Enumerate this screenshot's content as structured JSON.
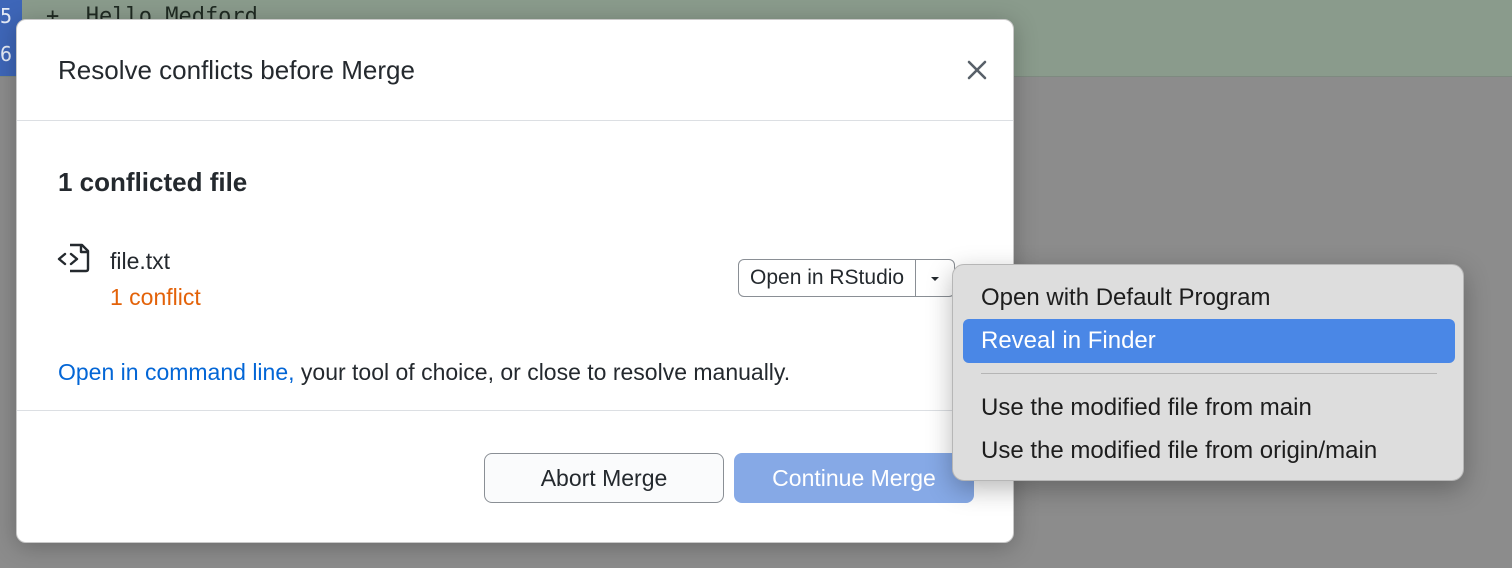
{
  "background": {
    "line_numbers": [
      "5",
      "6"
    ],
    "diff_line": "+  Hello Medford"
  },
  "dialog": {
    "title": "Resolve conflicts before Merge",
    "section_title": "1 conflicted file",
    "file": {
      "name": "file.txt",
      "conflicts": "1 conflict",
      "open_button_label": "Open in RStudio"
    },
    "footnote_link": "Open in command line,",
    "footnote_text": " your tool of choice, or close to resolve manually.",
    "abort_label": "Abort Merge",
    "continue_label": "Continue Merge"
  },
  "context_menu": {
    "items": [
      "Open with Default Program",
      "Reveal in Finder",
      "Use the modified file from main",
      "Use the modified file from origin/main"
    ],
    "highlighted": "Reveal in Finder"
  },
  "colors": {
    "conflict_orange": "#e36209",
    "link_blue": "#0366d6",
    "continue_blue": "#86a9e6",
    "menu_highlight": "#4a87e6"
  },
  "icons": [
    "close-icon",
    "file-code-icon",
    "chevron-down-icon"
  ]
}
